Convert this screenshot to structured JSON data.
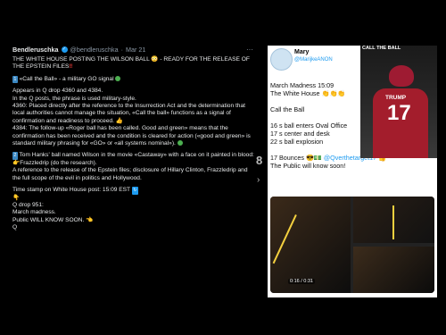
{
  "tweet": {
    "name": "Bendleruschka",
    "handle": "@bendleruschka",
    "date": "Mar 21",
    "headline": "THE WHITE HOUSE POSTING THE WILSON BALL 😳 - READY FOR THE RELEASE OF THE EPSTEIN FILES",
    "s1_title": "«Call the Ball» - a military GO signal",
    "s1_p1": "Appears in Q drop 4360 and 4384.",
    "s1_p2": "In the Q posts, the phrase is used military-style.",
    "s1_p3": "4360: Placed directly after the reference to the Insurrection Act and the determination that local authorities cannot manage the situation, «Call the ball» functions as a signal of confirmation and readiness to proceed. 👍",
    "s1_p4": "4384: The follow-up «Roger ball has been called. Good and green» means that the confirmation has been received and the condition is cleared for action («good and green» is standard military phrasing for «GO» or «all systems nominal»).",
    "s2_title": "Tom Hanks' ball named Wilson in the movie «Castaway» with a face on it painted in blood:",
    "s2_p1": "👉Frazzledrip (do the research).",
    "s2_p2": "A reference to the release of the Epstein files; disclosure of Hillary Clinton, Frazzledrip and the full scope of the evil in politics and Hollywood.",
    "time_stamp": "Time stamp on White House post: 15:09 EST",
    "q_drop": "Q drop 951:",
    "march": "March madness.",
    "public": "Public WILL KNOW SOON. 👈",
    "q": "Q"
  },
  "post": {
    "name": "Mary",
    "handle": "@MarijkeANON",
    "line1": "March Madness  15:09",
    "line2": "The White House",
    "call": "Call the Ball",
    "l16": "16 s  ball enters Oval Office",
    "l17": "17 s  center and desk",
    "l22": "22 s ball explosion",
    "bounces": "17 Bounces",
    "mention": "@Qverthetarget17",
    "public": "The Public will know soon!",
    "photo_caption": "CALL THE BALL",
    "jersey_name": "TRUMP",
    "jersey_num": "17",
    "video_time": "0:16 / 0:31"
  },
  "separator": "8"
}
